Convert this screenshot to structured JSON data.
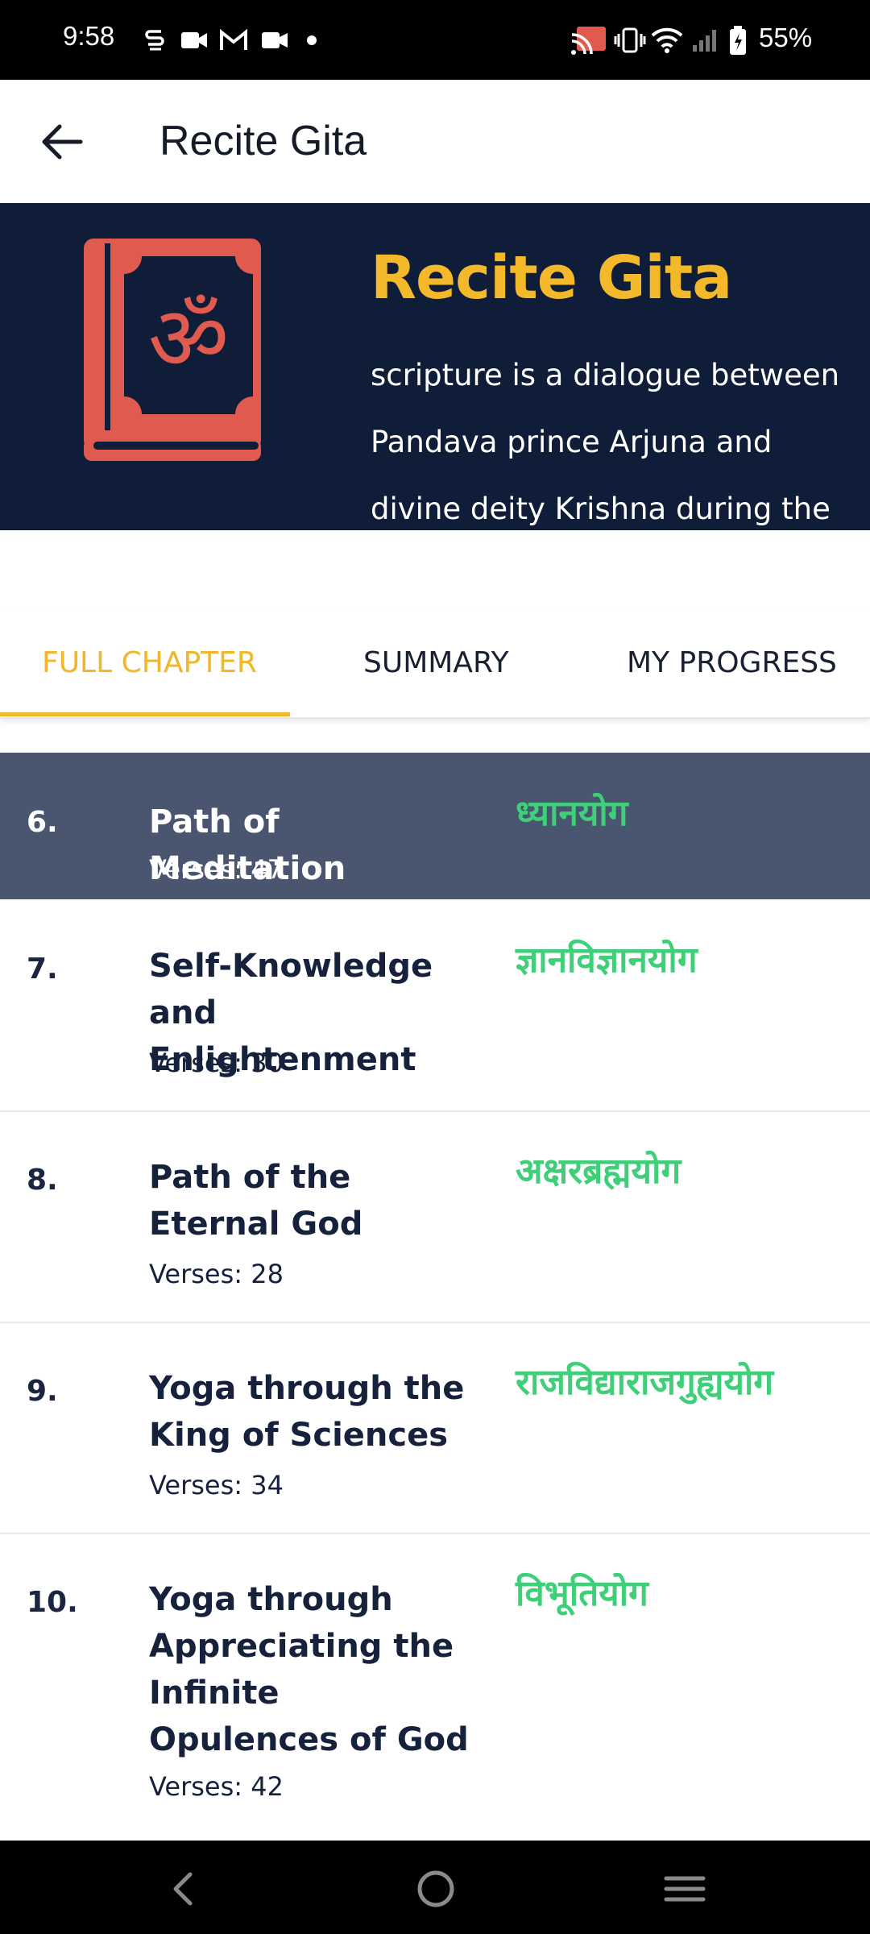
{
  "status": {
    "time": "9:58",
    "battery": "55%",
    "icons_left": [
      "sync-s-icon",
      "video-icon",
      "gmail-icon",
      "camera-icon",
      "dot-icon"
    ],
    "icons_right": [
      "cast-icon",
      "vibrate-icon",
      "wifi-icon",
      "signal-icon",
      "battery-icon"
    ]
  },
  "appbar": {
    "title": "Recite Gita"
  },
  "hero": {
    "title": "Recite Gita",
    "description": "scripture is a dialogue between Pandava prince Arjuna and divine deity Krishna during the",
    "icon": "om-book-icon",
    "icon_color": "#e05a4f",
    "title_color": "#f4b92b",
    "background": "#101d38"
  },
  "tabs": [
    {
      "label": "FULL CHAPTER",
      "active": true
    },
    {
      "label": "SUMMARY",
      "active": false
    },
    {
      "label": "MY PROGRESS",
      "active": false
    }
  ],
  "chapters": [
    {
      "num": "6.",
      "name": "Path of Meditation",
      "verses": "Verses: 47",
      "sanskrit": "ध्यानयोग",
      "selected": true
    },
    {
      "num": "7.",
      "name": "Self-Knowledge and Enlightenment",
      "verses": "Verses: 30",
      "sanskrit": "ज्ञानविज्ञानयोग",
      "selected": false
    },
    {
      "num": "8.",
      "name": "Path of the Eternal God",
      "verses": "Verses: 28",
      "sanskrit": "अक्षरब्रह्मयोग",
      "selected": false
    },
    {
      "num": "9.",
      "name": "Yoga through the King of Sciences",
      "verses": "Verses: 34",
      "sanskrit": "राजविद्याराजगुह्ययोग",
      "selected": false
    },
    {
      "num": "10.",
      "name": "Yoga through Appreciating the Infinite Opulences of God",
      "verses": "Verses: 42",
      "sanskrit": "विभूतियोग",
      "selected": false
    }
  ],
  "colors": {
    "accent": "#f1b62a",
    "sanskrit": "#3fcf78",
    "selected_row": "#4a5670",
    "text_dark": "#16213c"
  }
}
